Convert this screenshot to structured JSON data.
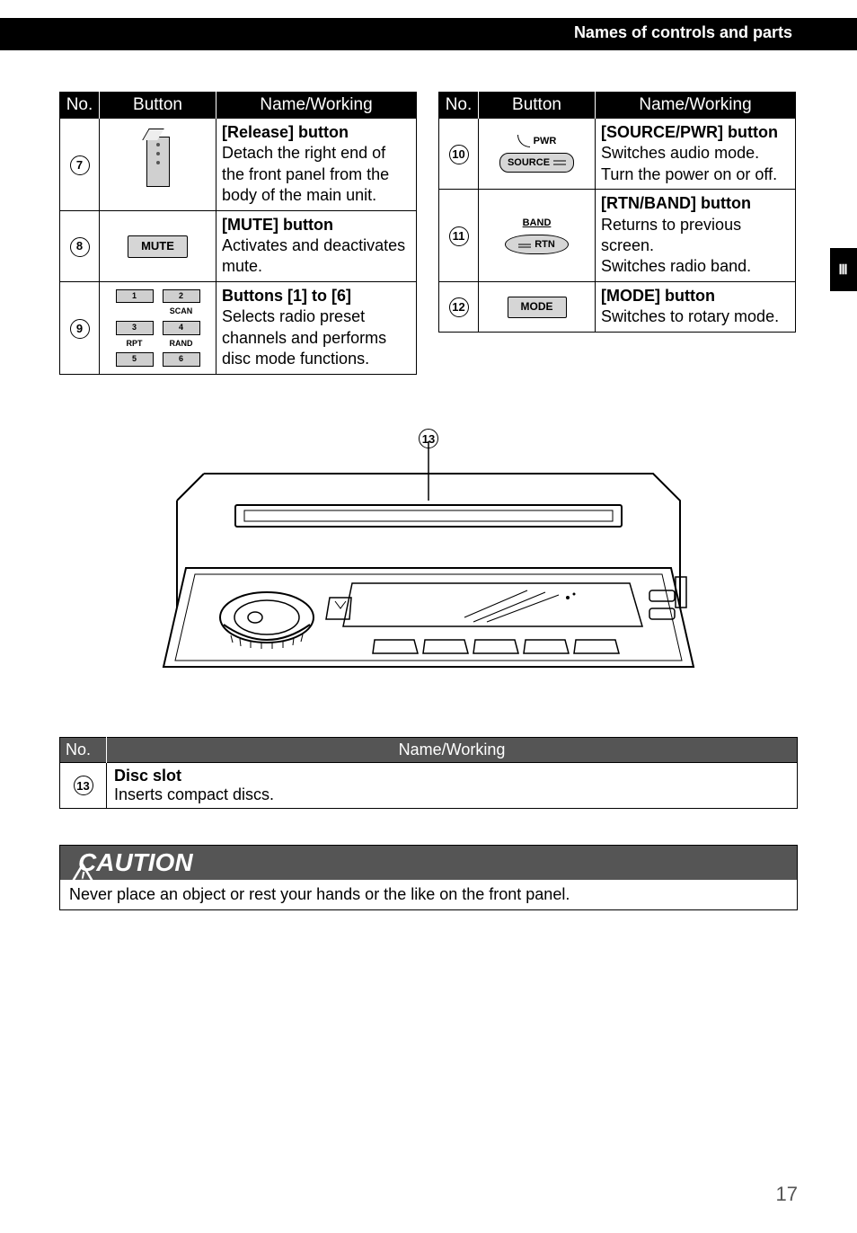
{
  "header": {
    "section_title": "Names of controls and parts"
  },
  "side_tab": "Ⅲ",
  "columns": {
    "no": "No.",
    "button": "Button",
    "namework": "Name/Working"
  },
  "left_table": [
    {
      "no": "7",
      "title": "[Release] button",
      "desc": "Detach the right end of the front panel from the body of the main unit.",
      "art": "release"
    },
    {
      "no": "8",
      "title": "[MUTE] button",
      "desc": "Activates and deactivates mute.",
      "art": "mute",
      "mute_label": "MUTE"
    },
    {
      "no": "9",
      "title": "Buttons [1] to [6]",
      "desc": "Selects radio preset channels and performs disc mode functions.",
      "art": "six",
      "six": {
        "b1": "1",
        "b2": "2",
        "b3": "3",
        "b4": "4",
        "b5": "5",
        "b6": "6",
        "scan": "SCAN",
        "rpt": "RPT",
        "rand": "RAND"
      }
    }
  ],
  "right_table": [
    {
      "no": "10",
      "title": "[SOURCE/PWR] button",
      "desc1": "Switches audio mode.",
      "desc2": "Turn the power on or off.",
      "art": "source",
      "pwr_label": "PWR",
      "source_label": "SOURCE"
    },
    {
      "no": "11",
      "title": "[RTN/BAND] button",
      "desc1": "Returns to previous screen.",
      "desc2": "Switches radio band.",
      "art": "rtn",
      "band_label": "BAND",
      "rtn_label": "RTN"
    },
    {
      "no": "12",
      "title": "[MODE] button",
      "desc1": "Switches to rotary mode.",
      "art": "mode",
      "mode_label": "MODE"
    }
  ],
  "diagram_no": "13",
  "disc_table": {
    "header_no": "No.",
    "header_nw": "Name/Working",
    "no": "13",
    "title": "Disc slot",
    "desc": "Inserts compact discs."
  },
  "caution": {
    "heading": "CAUTION",
    "body": "Never place an object or rest your hands or the like on the front panel."
  },
  "page_number": "17"
}
